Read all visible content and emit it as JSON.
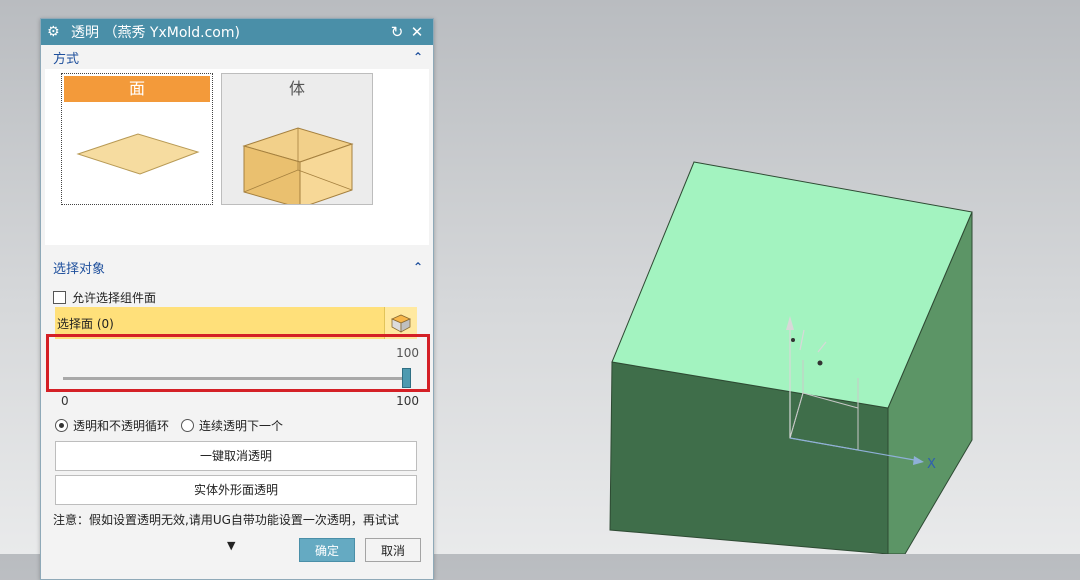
{
  "dialog": {
    "title": "透明 （燕秀 YxMold.com)",
    "icons": {
      "settings": "gear-icon",
      "reset": "refresh-icon",
      "close": "close-icon"
    },
    "mode_section": {
      "heading": "方式",
      "options": [
        {
          "label": "面",
          "selected": true
        },
        {
          "label": "体",
          "selected": false
        }
      ]
    },
    "select_section": {
      "heading": "选择对象",
      "allow_component_faces_label": "允许选择组件面",
      "select_face_label": "选择面 (0)",
      "slider": {
        "current": 100,
        "min_label": "0",
        "max_label": "100",
        "current_label": "100"
      },
      "radio_options": [
        {
          "label": "透明和不透明循环",
          "checked": true
        },
        {
          "label": "连续透明下一个",
          "checked": false
        }
      ],
      "clear_button": "一键取消透明",
      "solid_button": "实体外形面透明",
      "note": "注意：假如设置透明无效,请用UG自带功能设置一次透明，再试试"
    },
    "footer": {
      "ok": "确定",
      "cancel": "取消"
    }
  },
  "viewport": {
    "axis_label_x": "X",
    "colors": {
      "top_face": "#a3f3c0",
      "front_face": "#3d6b48",
      "side_face": "#5c9566",
      "accent": "#4a8fa8",
      "highlight": "#d42026"
    }
  }
}
